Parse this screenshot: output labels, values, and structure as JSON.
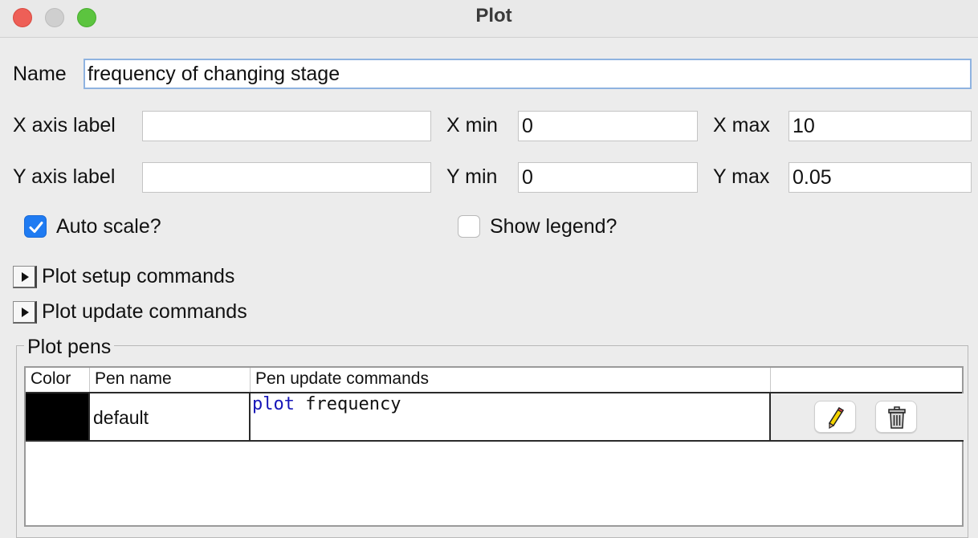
{
  "window": {
    "title": "Plot"
  },
  "form": {
    "name_label": "Name",
    "name_value": "frequency of changing stage",
    "x_axis_label_label": "X axis label",
    "x_axis_label_value": "",
    "y_axis_label_label": "Y axis label",
    "y_axis_label_value": "",
    "x_min_label": "X min",
    "x_min_value": "0",
    "x_max_label": "X max",
    "x_max_value": "10",
    "y_min_label": "Y min",
    "y_min_value": "0",
    "y_max_label": "Y max",
    "y_max_value": "0.05",
    "auto_scale_label": "Auto scale?",
    "auto_scale_checked": true,
    "show_legend_label": "Show legend?",
    "show_legend_checked": false
  },
  "sections": {
    "setup_label": "Plot setup commands",
    "update_label": "Plot update commands"
  },
  "pens": {
    "group_title": "Plot pens",
    "columns": [
      "Color",
      "Pen name",
      "Pen update commands",
      ""
    ],
    "rows": [
      {
        "color": "#000000",
        "name": "default",
        "command_keyword": "plot",
        "command_rest": " frequency",
        "edit_icon": "pencil-icon",
        "delete_icon": "trash-icon"
      }
    ]
  },
  "colors": {
    "checkbox_accent": "#1f7bf2",
    "keyword": "#1616b8"
  }
}
